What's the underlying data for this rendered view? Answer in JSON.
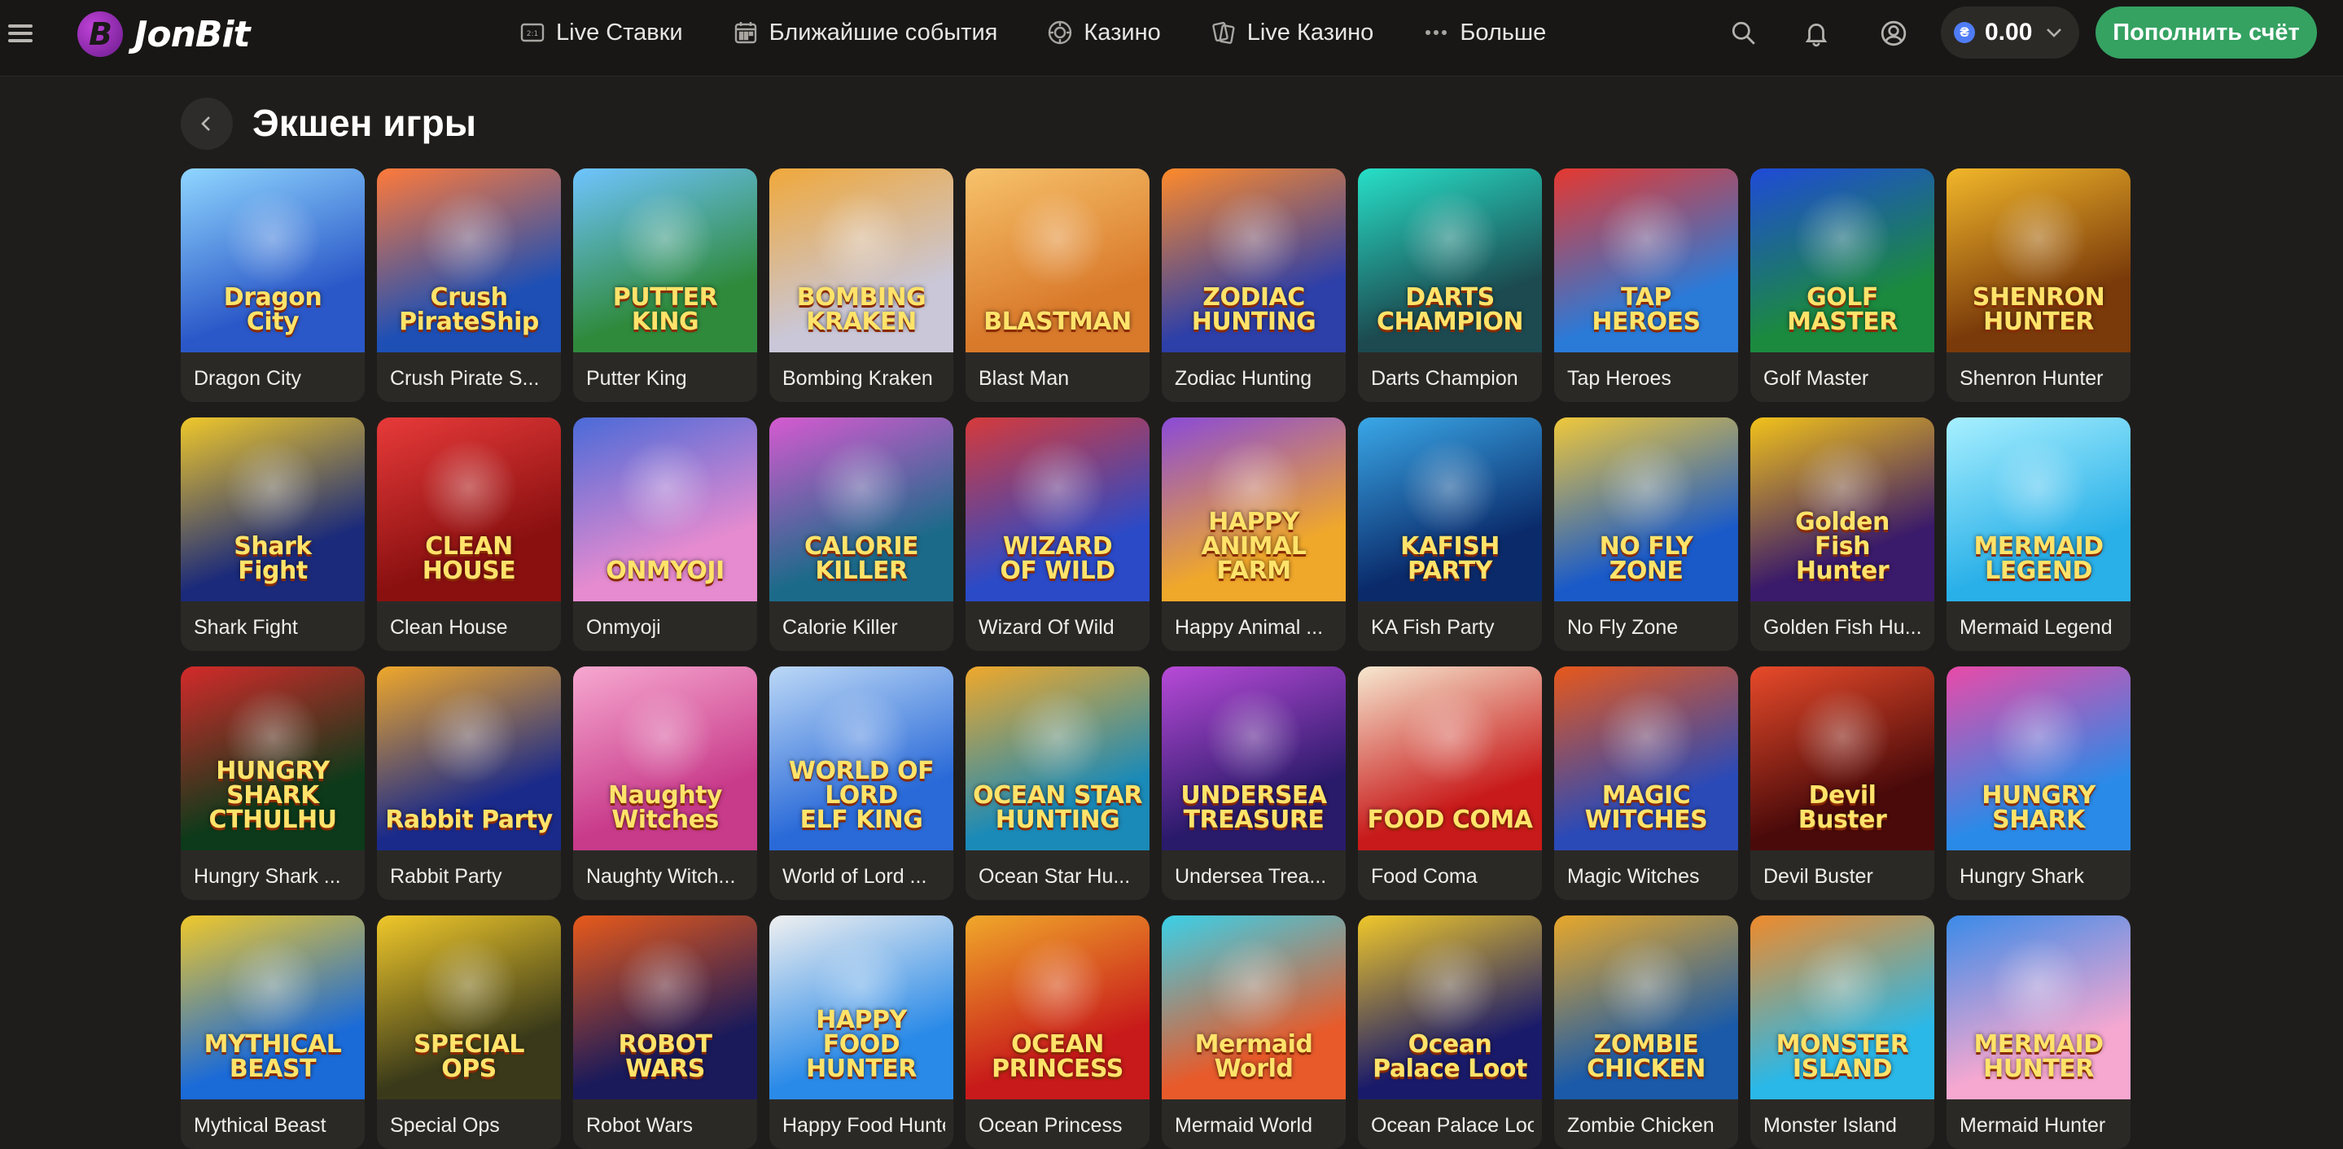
{
  "header": {
    "logo_text": "JonBit",
    "nav": [
      {
        "label": "Live Ставки",
        "icon": "live-bets-icon"
      },
      {
        "label": "Ближайшие события",
        "icon": "calendar-icon"
      },
      {
        "label": "Казино",
        "icon": "casino-chip-icon"
      },
      {
        "label": "Live Казино",
        "icon": "cards-icon"
      },
      {
        "label": "Больше",
        "icon": "more-dots-icon"
      }
    ],
    "balance": "0.00",
    "coin_symbol": "₴",
    "deposit_label": "Пополнить счёт"
  },
  "page": {
    "title": "Экшен игры"
  },
  "games": [
    {
      "name": "Dragon City",
      "art": "Dragon\nCity",
      "bg": "#2b58c8",
      "bg2": "#8fd6ff"
    },
    {
      "name": "Crush Pirate S...",
      "art": "Crush\nPirateShip",
      "bg": "#1d4fb5",
      "bg2": "#ff7a3a"
    },
    {
      "name": "Putter King",
      "art": "PUTTER KING",
      "bg": "#2f8a3c",
      "bg2": "#6fc4ff"
    },
    {
      "name": "Bombing Kraken",
      "art": "BOMBING\nKRAKEN",
      "bg": "#c9c7d8",
      "bg2": "#f0a83a"
    },
    {
      "name": "Blast Man",
      "art": "BLASTMAN",
      "bg": "#d97a2b",
      "bg2": "#f7c26b"
    },
    {
      "name": "Zodiac Hunting",
      "art": "ZODIAC\nHUNTING",
      "bg": "#2d3fa8",
      "bg2": "#ff8a2a"
    },
    {
      "name": "Darts Champion",
      "art": "DARTS\nCHAMPION",
      "bg": "#1c4a50",
      "bg2": "#27e0c8"
    },
    {
      "name": "Tap Heroes",
      "art": "TAP\nHEROES",
      "bg": "#2a7ad8",
      "bg2": "#e6382f"
    },
    {
      "name": "Golf Master",
      "art": "GOLF\nMASTER",
      "bg": "#1b8a3e",
      "bg2": "#1f4ad8"
    },
    {
      "name": "Shenron Hunter",
      "art": "SHENRON\nHUNTER",
      "bg": "#7a3a0a",
      "bg2": "#f2b72a"
    },
    {
      "name": "Shark Fight",
      "art": "Shark\nFight",
      "bg": "#1b2a7a",
      "bg2": "#f0c82a"
    },
    {
      "name": "Clean House",
      "art": "CLEAN\nHOUSE",
      "bg": "#8a1010",
      "bg2": "#e83a3a"
    },
    {
      "name": "Onmyoji",
      "art": "ONMYOJI",
      "bg": "#e68bd0",
      "bg2": "#4a6ad8"
    },
    {
      "name": "Calorie Killer",
      "art": "CALORIE\nKILLER",
      "bg": "#1c6a8a",
      "bg2": "#d65ad0"
    },
    {
      "name": "Wizard Of Wild",
      "art": "WIZARD\nOF WILD",
      "bg": "#2a4ac8",
      "bg2": "#d63a3a"
    },
    {
      "name": "Happy Animal ...",
      "art": "HAPPY\nANIMAL FARM",
      "bg": "#f0a82a",
      "bg2": "#8a4ad8"
    },
    {
      "name": "KA Fish Party",
      "art": "KAFISH PARTY",
      "bg": "#0a2a6a",
      "bg2": "#3aa8e8"
    },
    {
      "name": "No Fly Zone",
      "art": "NO FLY\nZONE",
      "bg": "#1a5ac8",
      "bg2": "#f0c83a"
    },
    {
      "name": "Golden Fish Hu...",
      "art": "Golden\nFish\nHunter",
      "bg": "#3a1a6a",
      "bg2": "#f2c21a"
    },
    {
      "name": "Mermaid Legend",
      "art": "MERMAID\nLEGEND",
      "bg": "#2ab0e8",
      "bg2": "#a8f0ff"
    },
    {
      "name": "Hungry Shark ...",
      "art": "HUNGRY SHARK\nCTHULHU",
      "bg": "#0c3a1a",
      "bg2": "#d42a2a"
    },
    {
      "name": "Rabbit Party",
      "art": "Rabbit Party",
      "bg": "#1a2a8a",
      "bg2": "#f0a82a"
    },
    {
      "name": "Naughty Witch...",
      "art": "Naughty\nWitches",
      "bg": "#c83a8a",
      "bg2": "#f6a8d0"
    },
    {
      "name": "World of Lord ...",
      "art": "WORLD OF LORD\nELF KING",
      "bg": "#2a6ad8",
      "bg2": "#bcd8f6"
    },
    {
      "name": "Ocean Star Hu...",
      "art": "OCEAN STAR\nHUNTING",
      "bg": "#1a8ab8",
      "bg2": "#f0a82a"
    },
    {
      "name": "Undersea Trea...",
      "art": "UNDERSEA\nTREASURE",
      "bg": "#2a1a6a",
      "bg2": "#b84ad8"
    },
    {
      "name": "Food Coma",
      "art": "FOOD COMA",
      "bg": "#c81a1a",
      "bg2": "#f6e8d0"
    },
    {
      "name": "Magic Witches",
      "art": "MAGIC\nWITCHES",
      "bg": "#2a4ab8",
      "bg2": "#e8581a"
    },
    {
      "name": "Devil Buster",
      "art": "Devil\nBuster",
      "bg": "#4a0a0a",
      "bg2": "#e84a2a"
    },
    {
      "name": "Hungry Shark",
      "art": "HUNGRY\nSHARK",
      "bg": "#2a8ae8",
      "bg2": "#ea4aa8"
    },
    {
      "name": "Mythical Beast",
      "art": "MYTHICAL\nBEAST",
      "bg": "#1a6ad8",
      "bg2": "#f0c82a"
    },
    {
      "name": "Special Ops",
      "art": "SPECIAL\nOPS",
      "bg": "#3a3a1a",
      "bg2": "#f0c82a"
    },
    {
      "name": "Robot Wars",
      "art": "ROBOT\nWARS",
      "bg": "#1a1a5a",
      "bg2": "#e85a1a"
    },
    {
      "name": "Happy Food Hunter",
      "art": "HAPPY\nFOOD HUNTER",
      "bg": "#2a8ae8",
      "bg2": "#f0f0f0"
    },
    {
      "name": "Ocean Princess",
      "art": "OCEAN\nPRINCESS",
      "bg": "#c81a1a",
      "bg2": "#f0a82a"
    },
    {
      "name": "Mermaid World",
      "art": "Mermaid\nWorld",
      "bg": "#e85a2a",
      "bg2": "#3ad0e8"
    },
    {
      "name": "Ocean Palace Loot",
      "art": "Ocean\nPalace Loot",
      "bg": "#1a1a6a",
      "bg2": "#f0c82a"
    },
    {
      "name": "Zombie Chicken",
      "art": "ZOMBIE\nCHICKEN",
      "bg": "#1a5aa8",
      "bg2": "#e8a82a"
    },
    {
      "name": "Monster Island",
      "art": "MONSTER\nISLAND",
      "bg": "#2ab8e8",
      "bg2": "#f08a2a"
    },
    {
      "name": "Mermaid Hunter",
      "art": "MERMAID\nHUNTER",
      "bg": "#f6a8d0",
      "bg2": "#3a8ae8"
    }
  ]
}
